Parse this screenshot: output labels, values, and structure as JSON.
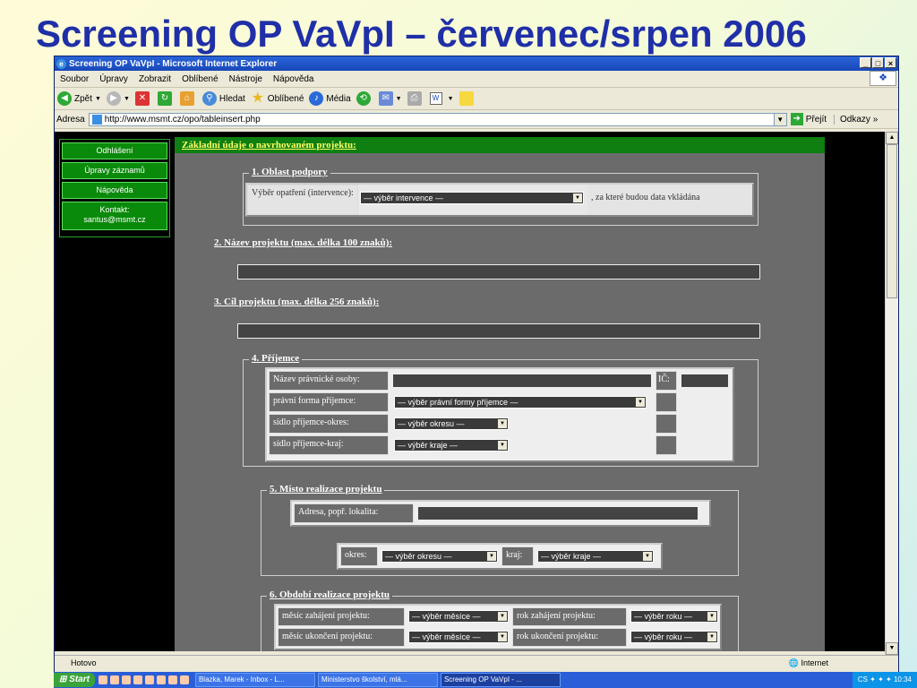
{
  "slide": {
    "title": "Screening OP VaVpI – červenec/srpen 2006"
  },
  "window": {
    "title": "Screening OP VaVpI - Microsoft Internet Explorer",
    "controls": [
      "_",
      "□",
      "×"
    ]
  },
  "menu": [
    "Soubor",
    "Úpravy",
    "Zobrazit",
    "Oblíbené",
    "Nástroje",
    "Nápověda"
  ],
  "toolbar": {
    "back": "Zpět",
    "search": "Hledat",
    "favorites": "Oblíbené",
    "media": "Média"
  },
  "address": {
    "label": "Adresa",
    "url": "http://www.msmt.cz/opo/tableinsert.php",
    "go": "Přejít",
    "links": "Odkazy"
  },
  "nav": [
    {
      "label": "Odhlášení"
    },
    {
      "label": "Úpravy záznamů"
    },
    {
      "label": "Nápověda"
    },
    {
      "label": "Kontakt:",
      "sub": "santus@msmt.cz"
    }
  ],
  "form": {
    "header": "Základní údaje o navrhovaném projektu:",
    "s1": {
      "legend": "1. Oblast podpory",
      "label": "Výběr opatření (intervence):",
      "select": "— výběr intervence —",
      "suffix": ", za které budou data vkládána"
    },
    "s2": {
      "label": "2. Název projektu (max. délka 100 znaků):"
    },
    "s3": {
      "label": "3. Cíl projektu (max. délka 256 znaků):"
    },
    "s4": {
      "legend": "4. Příjemce",
      "name_label": "Název právnické osoby:",
      "ic_label": "IČ:",
      "legal_label": "právní forma příjemce:",
      "legal_select": "— výběr právní formy příjemce —",
      "district_label": "sídlo příjemce-okres:",
      "district_select": "— výběr okresu —",
      "region_label": "sídlo příjemce-kraj:",
      "region_select": "— výběr kraje —"
    },
    "s5": {
      "legend": "5. Místo realizace projektu",
      "address_label": "Adresa, popř. lokalita:",
      "district_label": "okres:",
      "district_select": "— výběr okresu —",
      "region_label": "kraj:",
      "region_select": "— výběr kraje —"
    },
    "s6": {
      "legend": "6. Období realizace projektu",
      "start_month_label": "měsíc zahájení projektu:",
      "month_select": "— výběr měsíce —",
      "start_year_label": "rok zahájení projektu:",
      "year_select": "— výběr roku —",
      "end_month_label": "měsíc ukončení projektu:",
      "end_year_label": "rok ukončení projektu:"
    }
  },
  "status": {
    "text": "Hotovo",
    "zone": "Internet"
  },
  "taskbar": {
    "start": "Start",
    "tasks": [
      "Blazka, Marek - Inbox - L...",
      "Ministerstvo školství, mlá...",
      "Screening OP VaVpI - ..."
    ],
    "lang": "CS",
    "time": "10:34"
  }
}
